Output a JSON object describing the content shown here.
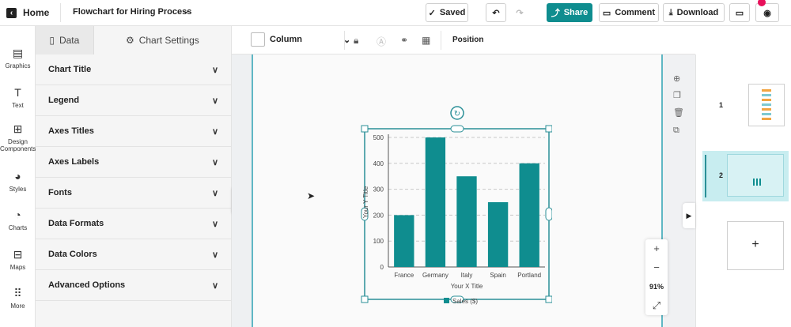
{
  "header": {
    "home_label": "Home",
    "doc_title": "Flowchart for Hiring Process",
    "saved_label": "Saved",
    "share_label": "Share",
    "comment_label": "Comment",
    "download_label": "Download"
  },
  "rail": {
    "items": [
      {
        "label": "Graphics",
        "icon": "graphics-icon"
      },
      {
        "label": "Text",
        "icon": "text-icon"
      },
      {
        "label": "Design Components",
        "icon": "components-icon"
      },
      {
        "label": "Styles",
        "icon": "palette-icon"
      },
      {
        "label": "Charts",
        "icon": "pie-chart-icon"
      },
      {
        "label": "Maps",
        "icon": "map-icon"
      },
      {
        "label": "More",
        "icon": "grid-icon"
      }
    ]
  },
  "panel": {
    "tabs": [
      {
        "label": "Data",
        "icon": "data-icon"
      },
      {
        "label": "Chart Settings",
        "icon": "gear-icon"
      }
    ],
    "sections": [
      {
        "label": "Chart Title"
      },
      {
        "label": "Legend"
      },
      {
        "label": "Axes Titles"
      },
      {
        "label": "Axes Labels"
      },
      {
        "label": "Fonts"
      },
      {
        "label": "Data Formats"
      },
      {
        "label": "Data Colors"
      },
      {
        "label": "Advanced Options"
      }
    ]
  },
  "toolbar": {
    "chart_type_label": "Column",
    "position_label": "Position"
  },
  "zoom": {
    "percent": "91%"
  },
  "pages": {
    "items": [
      {
        "number": "1"
      },
      {
        "number": "2"
      }
    ],
    "add_label": "+"
  },
  "colors": {
    "accent": "#0f8d8f",
    "page_border": "#5fb7c4"
  },
  "chart_data": {
    "type": "bar",
    "categories": [
      "France",
      "Germany",
      "Italy",
      "Spain",
      "Portland"
    ],
    "values": [
      200,
      500,
      350,
      250,
      400
    ],
    "xlabel": "Your X Title",
    "ylabel": "Your Y Title",
    "ylim": [
      0,
      500
    ],
    "yticks": [
      "0",
      "100",
      "200",
      "300",
      "400",
      "500"
    ],
    "legend": "Sales ($)",
    "grid": true,
    "color": "#0f8d8f"
  }
}
